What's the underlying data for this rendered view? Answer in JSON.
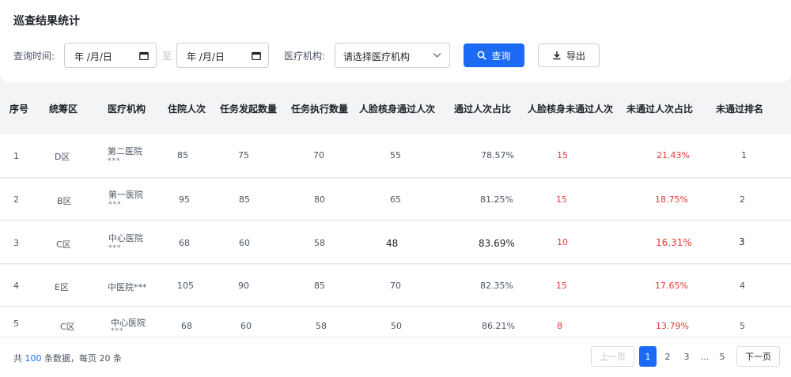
{
  "title": "巡查结果统计",
  "filters": {
    "time_label": "查询时间:",
    "start_date": "年 /月/日",
    "separator": "至",
    "end_date": "年 /月/日",
    "org_label": "医疗机构:",
    "org_select": "请选择医疗机构",
    "query_button": "查询",
    "export_button": "导出"
  },
  "table": {
    "headers": [
      "序号",
      "统筹区",
      "医疗机构",
      "住院人次",
      "任务发起数量",
      "任务执行数量",
      "人脸核身通过人次",
      "通过人次占比",
      "人脸核身未通过人次",
      "未通过人次占比",
      "未通过排名"
    ],
    "rows": [
      {
        "idx": "1",
        "area": "D区",
        "org": "第二医院",
        "org_sub": "***",
        "inpatient": "85",
        "initiated": "75",
        "executed": "70",
        "passed": "55",
        "pass_ratio": "78.57%",
        "failed": "15",
        "fail_ratio": "21.43%",
        "rank": "1"
      },
      {
        "idx": "2",
        "area": "B区",
        "org": "第一医院",
        "org_sub": "***",
        "inpatient": "95",
        "initiated": "85",
        "executed": "80",
        "passed": "65",
        "pass_ratio": "81.25%",
        "failed": "15",
        "fail_ratio": "18.75%",
        "rank": "2"
      },
      {
        "idx": "3",
        "area": "C区",
        "org": "中心医院",
        "org_sub": "***",
        "inpatient": "68",
        "initiated": "60",
        "executed": "58",
        "passed": "48",
        "pass_ratio": "83.69%",
        "failed": "10",
        "fail_ratio": "16.31%",
        "rank": "3"
      },
      {
        "idx": "4",
        "area": "E区",
        "org": "中医院***",
        "org_sub": "",
        "inpatient": "105",
        "initiated": "90",
        "executed": "85",
        "passed": "70",
        "pass_ratio": "82.35%",
        "failed": "15",
        "fail_ratio": "17.65%",
        "rank": "4"
      },
      {
        "idx": "5",
        "area": "C区",
        "org": "中心医院",
        "org_sub": "***",
        "inpatient": "68",
        "initiated": "60",
        "executed": "58",
        "passed": "50",
        "pass_ratio": "86.21%",
        "failed": "8",
        "fail_ratio": "13.79%",
        "rank": "5"
      }
    ]
  },
  "pagination": {
    "total_prefix": "共",
    "total_count": "100",
    "total_suffix": "条数据，每页 20 条",
    "prev": "上一页",
    "pages": [
      "1",
      "2",
      "3",
      "...",
      "5"
    ],
    "current": "1",
    "next": "下一页"
  },
  "colors": {
    "accent": "#1a6af5",
    "danger": "#e53935"
  }
}
